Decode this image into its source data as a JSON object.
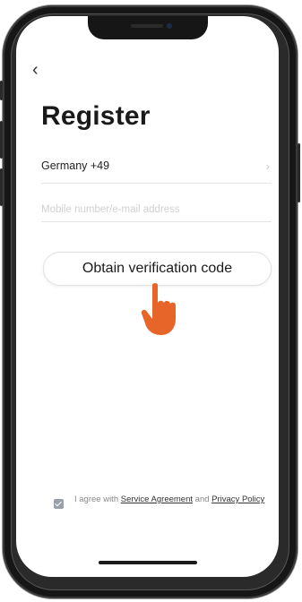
{
  "nav": {
    "back_label": "‹"
  },
  "page": {
    "title": "Register"
  },
  "form": {
    "country_label": "Germany +49",
    "chevron": "›",
    "account_placeholder": "Mobile number/e-mail address",
    "verify_button_label": "Obtain verification code"
  },
  "agreement": {
    "prefix": "I agree with ",
    "service_link": "Service Agreement",
    "conjunction": " and ",
    "privacy_link": "Privacy Policy",
    "checked": true
  },
  "colors": {
    "hand": "#E8652A",
    "checkbox": "#9aa0a8"
  },
  "icons": {
    "back": "chevron-left-icon",
    "row": "chevron-right-icon",
    "pointer": "pointing-hand-icon"
  }
}
